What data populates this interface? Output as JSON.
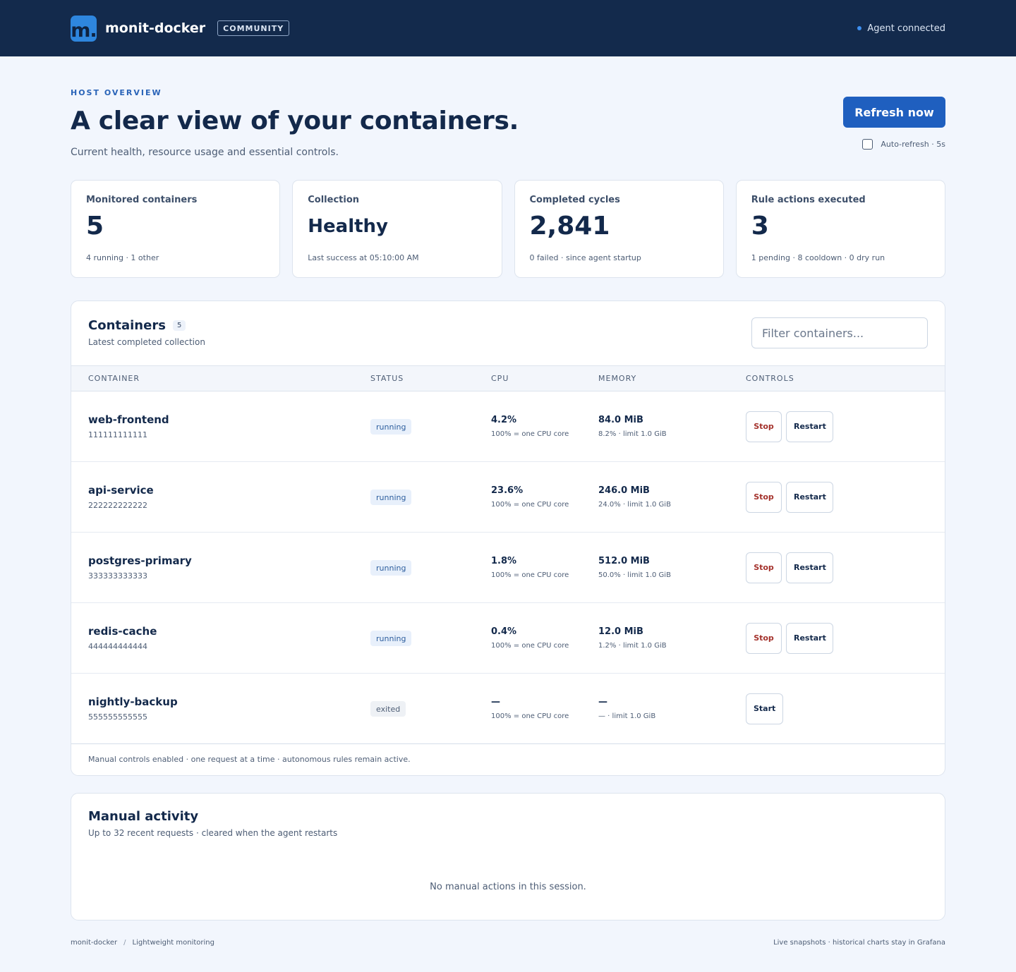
{
  "header": {
    "logo_text": "m.",
    "app_name": "monit-docker",
    "edition": "COMMUNITY",
    "agent_status": "Agent connected",
    "accent_color": "#2e86de"
  },
  "hero": {
    "eyebrow": "HOST OVERVIEW",
    "title": "A clear view of your containers.",
    "subtitle": "Current health, resource usage and essential controls.",
    "refresh_label": "Refresh now",
    "auto_refresh_label": "Auto-refresh · 5s",
    "auto_refresh_checked": false
  },
  "stats": [
    {
      "label": "Monitored containers",
      "value": "5",
      "note": "4 running · 1 other"
    },
    {
      "label": "Collection",
      "value": "Healthy",
      "note": "Last success at 05:10:00 AM"
    },
    {
      "label": "Completed cycles",
      "value": "2,841",
      "note": "0 failed · since agent startup"
    },
    {
      "label": "Rule actions executed",
      "value": "3",
      "note": "1 pending · 8 cooldown · 0 dry run"
    }
  ],
  "containers": {
    "title": "Containers",
    "count": "5",
    "subtitle": "Latest completed collection",
    "filter_placeholder": "Filter containers...",
    "columns": [
      "CONTAINER",
      "STATUS",
      "CPU",
      "MEMORY",
      "CONTROLS"
    ],
    "rows": [
      {
        "name": "web-frontend",
        "id": "111111111111",
        "status": "running",
        "cpu": "4.2%",
        "cpu_note": "100% = one CPU core",
        "mem": "84.0 MiB",
        "mem_note": "8.2% · limit 1.0 GiB",
        "stop_label": "Stop",
        "restart_label": "Restart"
      },
      {
        "name": "api-service",
        "id": "222222222222",
        "status": "running",
        "cpu": "23.6%",
        "cpu_note": "100% = one CPU core",
        "mem": "246.0 MiB",
        "mem_note": "24.0% · limit 1.0 GiB",
        "stop_label": "Stop",
        "restart_label": "Restart"
      },
      {
        "name": "postgres-primary",
        "id": "333333333333",
        "status": "running",
        "cpu": "1.8%",
        "cpu_note": "100% = one CPU core",
        "mem": "512.0 MiB",
        "mem_note": "50.0% · limit 1.0 GiB",
        "stop_label": "Stop",
        "restart_label": "Restart"
      },
      {
        "name": "redis-cache",
        "id": "444444444444",
        "status": "running",
        "cpu": "0.4%",
        "cpu_note": "100% = one CPU core",
        "mem": "12.0 MiB",
        "mem_note": "1.2% · limit 1.0 GiB",
        "stop_label": "Stop",
        "restart_label": "Restart"
      },
      {
        "name": "nightly-backup",
        "id": "555555555555",
        "status": "exited",
        "cpu": "—",
        "cpu_note": "100% = one CPU core",
        "mem": "—",
        "mem_note": "— · limit 1.0 GiB",
        "start_label": "Start"
      }
    ],
    "footer_note": "Manual controls enabled · one request at a time · autonomous rules remain active."
  },
  "activity": {
    "title": "Manual activity",
    "subtitle": "Up to 32 recent requests · cleared when the agent restarts",
    "empty": "No manual actions in this session."
  },
  "footer": {
    "left_app": "monit-docker",
    "left_separator": "/",
    "left_tagline": "Lightweight monitoring",
    "right": "Live snapshots · historical charts stay in Grafana"
  }
}
